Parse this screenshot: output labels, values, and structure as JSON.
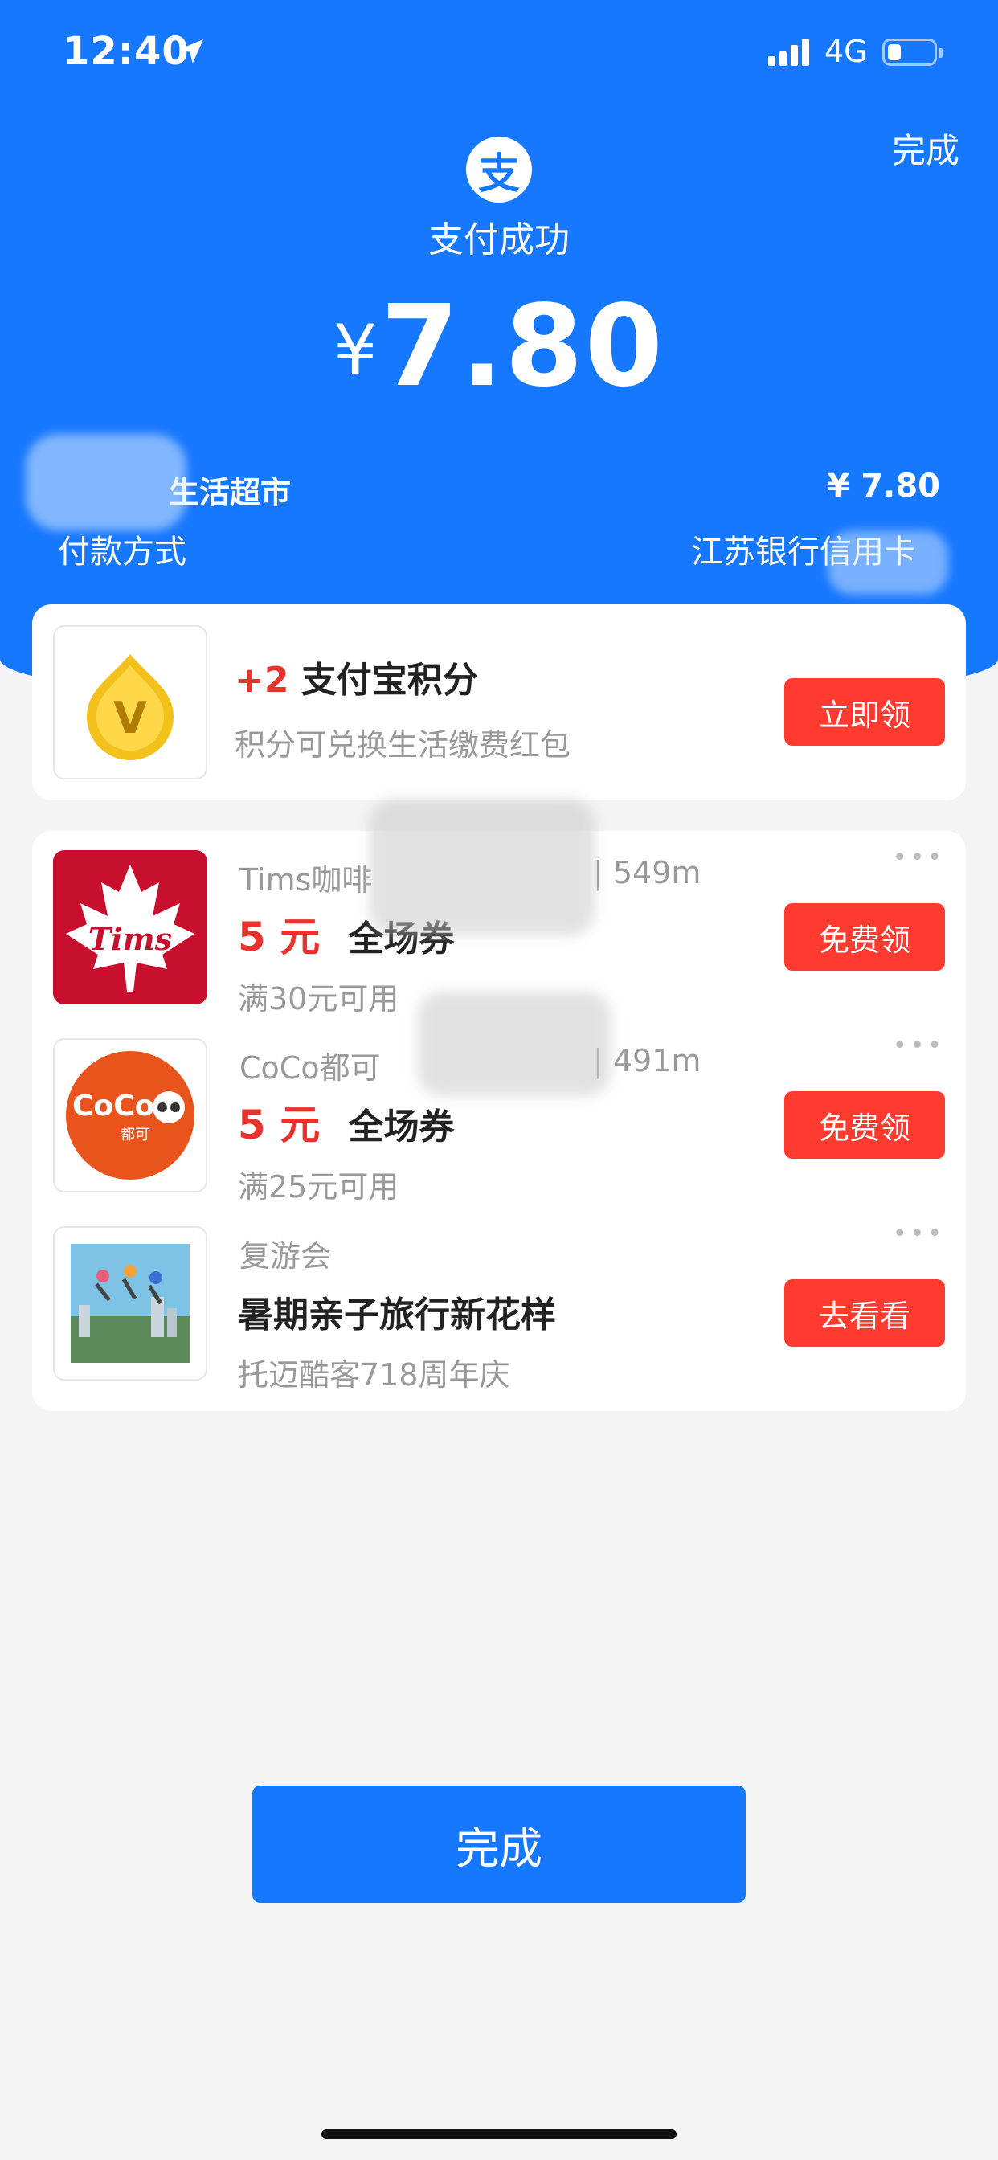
{
  "status_bar": {
    "time": "12:40",
    "network": "4G"
  },
  "header": {
    "done_label": "完成",
    "logo_glyph": "支",
    "success_text": "支付成功",
    "currency": "¥",
    "amount": "7.80"
  },
  "payment": {
    "merchant": "生活超市",
    "merchant_amount": "¥ 7.80",
    "method_label": "付款方式",
    "method_value": "江苏银行信用卡"
  },
  "points": {
    "plus": "+2",
    "title": "支付宝积分",
    "subtitle": "积分可兑换生活缴费红包",
    "button": "立即领",
    "icon_glyph": "V"
  },
  "offers": [
    {
      "store": "Tims咖啡",
      "distance": "| 549m",
      "amount": "5 元",
      "title": "全场券",
      "condition": "满30元可用",
      "button": "免费领",
      "logo_text": "Tims",
      "more": "•••"
    },
    {
      "store": "CoCo都可",
      "distance": "| 491m",
      "amount": "5 元",
      "title": "全场券",
      "condition": "满25元可用",
      "button": "免费领",
      "logo_text": "CoCo",
      "logo_sub": "都可",
      "more": "•••"
    },
    {
      "store": "复游会",
      "title": "暑期亲子旅行新花样",
      "condition": "托迈酷客718周年庆",
      "button": "去看看",
      "more": "•••"
    }
  ],
  "footer": {
    "done_label": "完成"
  },
  "colors": {
    "brand_blue": "#1677ff",
    "accent_red": "#ff3b30"
  }
}
